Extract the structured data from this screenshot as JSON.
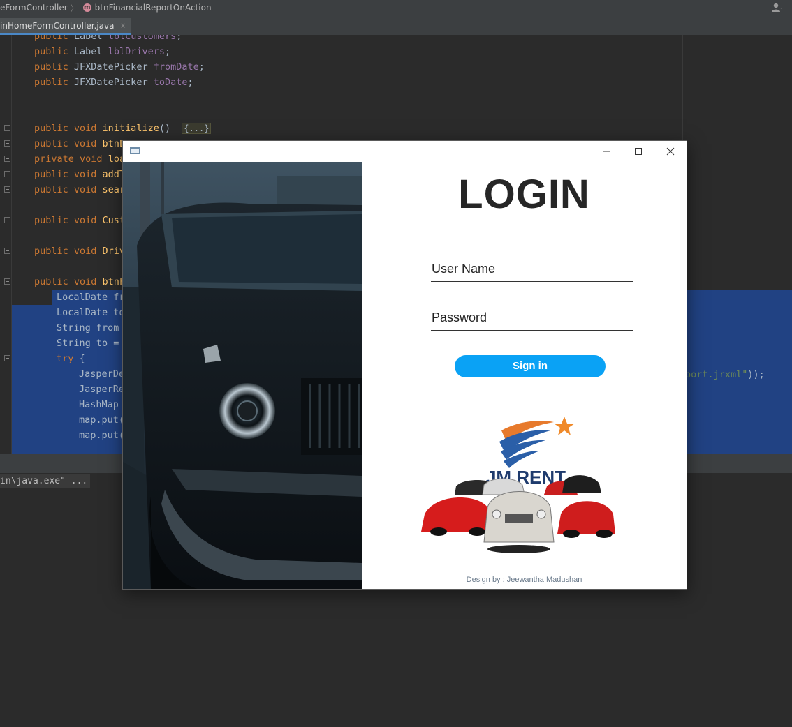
{
  "ide": {
    "breadcrumb": {
      "class_crumb": "eFormController",
      "method_badge": "m",
      "method_crumb": "btnFinancialReportOnAction"
    },
    "tab": {
      "label": "inHomeFormController.java",
      "close": "×"
    },
    "code": {
      "line1": [
        "public",
        " Label ",
        "lblCustomers",
        ";"
      ],
      "line2": [
        "public",
        " Label ",
        "lblDrivers",
        ";"
      ],
      "line3": [
        "public",
        " JFXDatePicker ",
        "fromDate",
        ";"
      ],
      "line4": [
        "public",
        " JFXDatePicker ",
        "toDate",
        ";"
      ],
      "init": {
        "kw": "public void",
        "fn": "initialize",
        "rest": "()  ",
        "fold": "{...}"
      },
      "btnl": {
        "kw": "public void",
        "fn": "btnL"
      },
      "loa": {
        "kw": "private void",
        "fn": "loa"
      },
      "addt": {
        "kw": "public void",
        "fn": "addT"
      },
      "sear": {
        "kw": "public void",
        "fn": "sear"
      },
      "cust": {
        "kw": "public void",
        "fn": "Cust"
      },
      "driv": {
        "kw": "public void",
        "fn": "Driv"
      },
      "btnf": {
        "kw": "public void",
        "fn": "btnF"
      },
      "sel1": "LocalDate fr",
      "sel2": "LocalDate to",
      "sel3": "String from",
      "sel4": "String to =",
      "sel5_kw": "try",
      "sel5_rest": " {",
      "sel6": "JasperDe",
      "sel7": "JasperRe",
      "sel8": "HashMap",
      "sel9": "map.put(",
      "sel10": "map.put(",
      "right_str": "port.jrxml\"",
      "right_tail": "));"
    },
    "console": "in\\java.exe\" ..."
  },
  "login_window": {
    "title": "LOGIN",
    "username_placeholder": "User Name",
    "password_placeholder": "Password",
    "signin_label": "Sign in",
    "logo_text": "JM RENT",
    "credit": "Design by : Jeewantha Madushan",
    "colors": {
      "accent": "#0aa2f5",
      "logo_text": "#1f3b6d",
      "logo_star": "#f08a2a"
    }
  }
}
